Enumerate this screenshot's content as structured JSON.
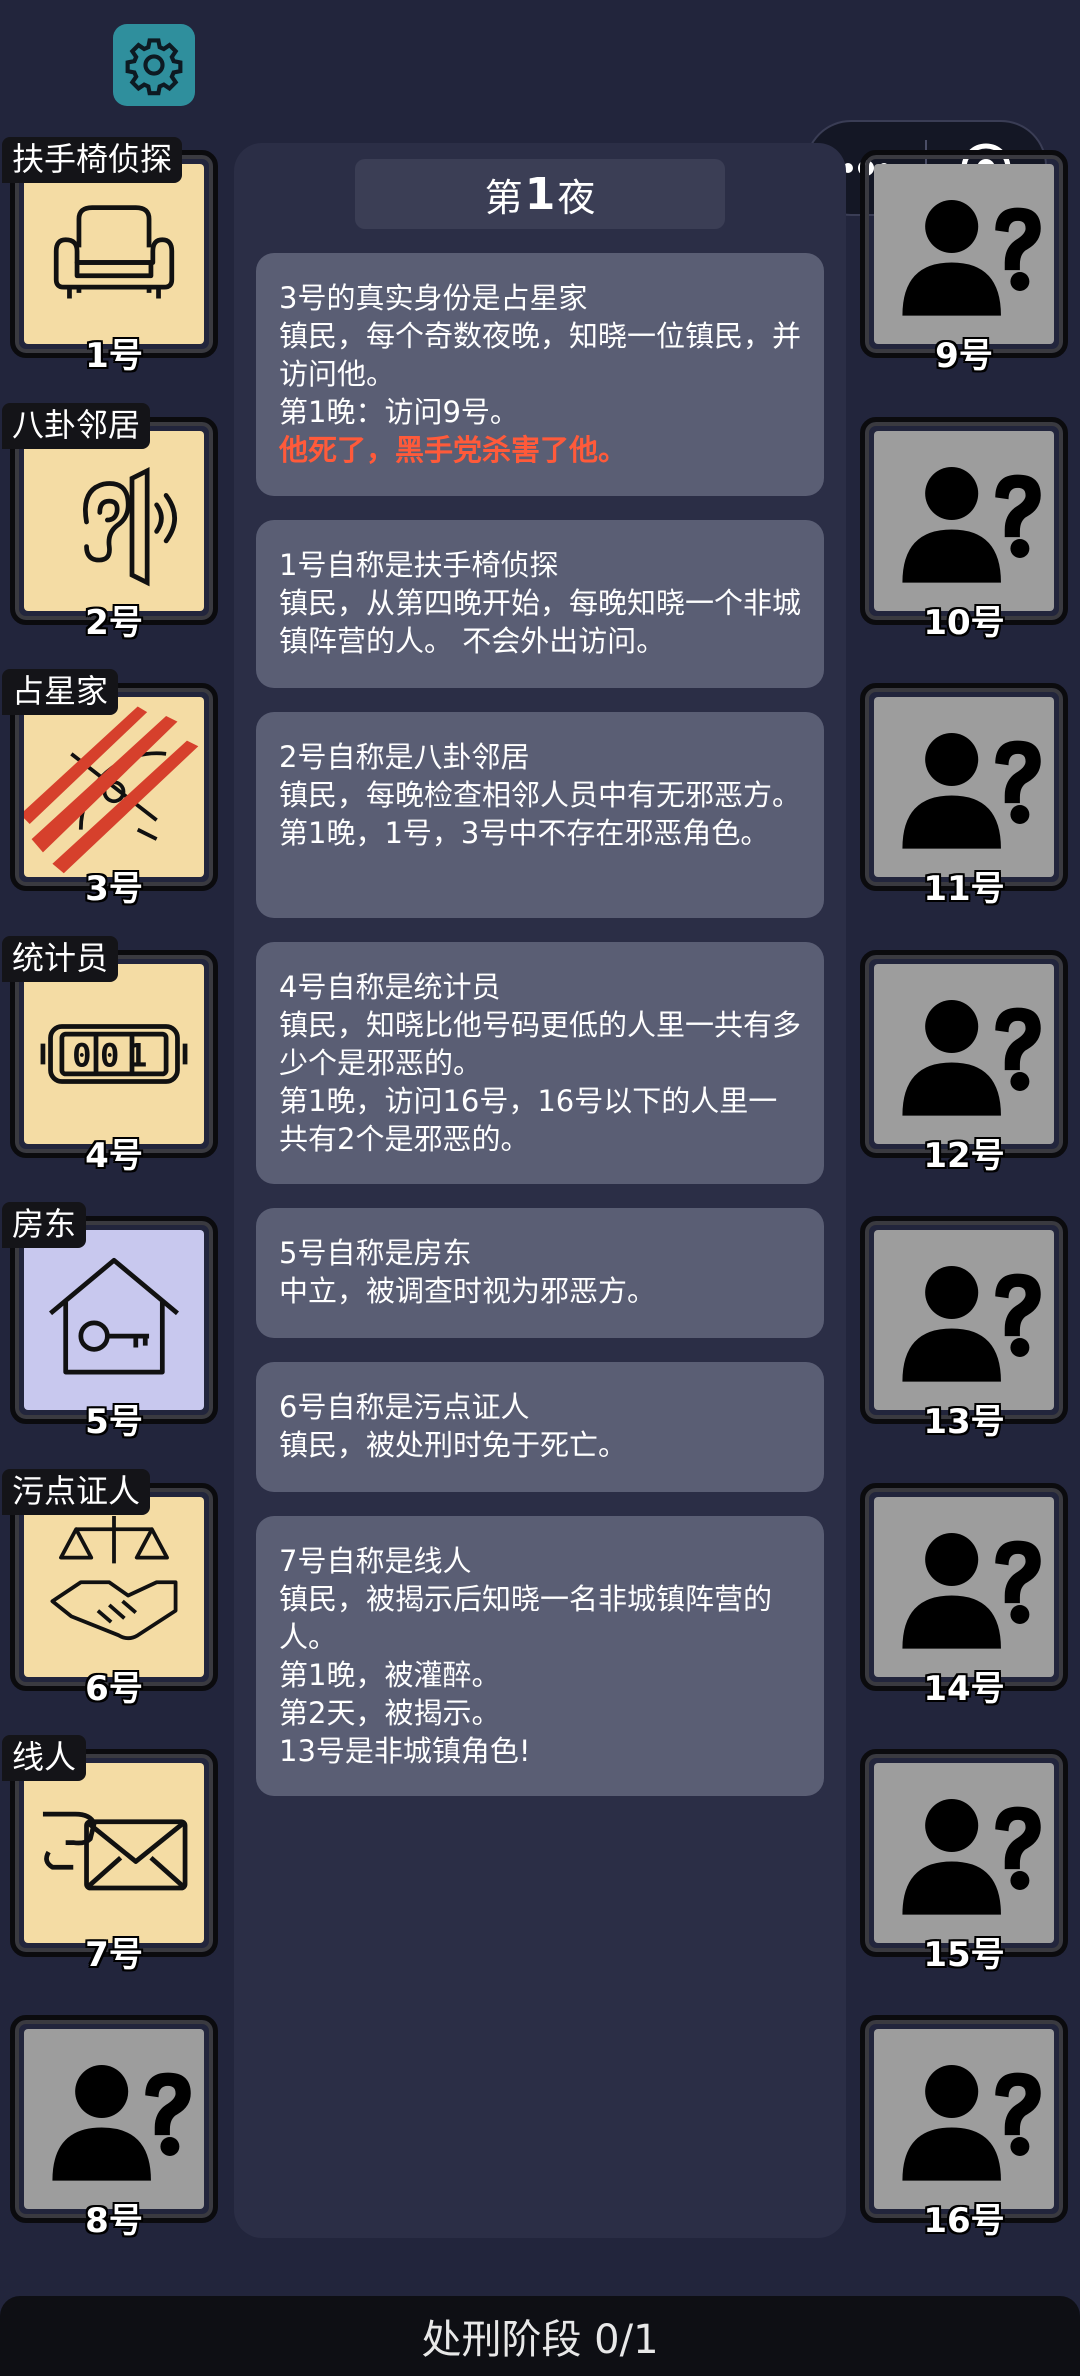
{
  "night": {
    "prefix": "第",
    "number": "1",
    "suffix": "夜"
  },
  "messages": [
    {
      "lines": [
        "3号的真实身份是占星家",
        "镇民，每个奇数夜晚，知晓一位镇民，并访问他。",
        "第1晚：访问9号。"
      ],
      "alert": "他死了，黑手党杀害了他。"
    },
    {
      "lines": [
        "1号自称是扶手椅侦探",
        "镇民，从第四晚开始，每晚知晓一个非城镇阵营的人。 不会外出访问。"
      ]
    },
    {
      "lines": [
        "2号自称是八卦邻居",
        "镇民，每晚检查相邻人员中有无邪恶方。",
        "第1晚，1号，3号中不存在邪恶角色。"
      ]
    },
    {
      "lines": [
        "4号自称是统计员",
        "镇民，知晓比他号码更低的人里一共有多少个是邪恶的。",
        "第1晚，访问16号，16号以下的人里一共有2个是邪恶的。"
      ]
    },
    {
      "lines": [
        "5号自称是房东",
        "中立，被调查时视为邪恶方。"
      ]
    },
    {
      "lines": [
        "6号自称是污点证人",
        "镇民，被处刑时免于死亡。"
      ]
    },
    {
      "lines": [
        "7号自称是线人",
        "镇民，被揭示后知晓一名非城镇阵营的人。",
        "第1晚，被灌醉。",
        "第2天，被揭示。",
        "13号是非城镇角色!"
      ]
    }
  ],
  "players_left": [
    {
      "number": "1号",
      "role": "扶手椅侦探",
      "icon": "armchair-icon",
      "bg": "yellow"
    },
    {
      "number": "2号",
      "role": "八卦邻居",
      "icon": "ear-wall-icon",
      "bg": "yellow"
    },
    {
      "number": "3号",
      "role": "占星家",
      "icon": "sextant-icon",
      "bg": "yellow",
      "dead": true
    },
    {
      "number": "4号",
      "role": "统计员",
      "icon": "counter-icon",
      "counter": "001",
      "bg": "yellow"
    },
    {
      "number": "5号",
      "role": "房东",
      "icon": "house-key-icon",
      "bg": "lilac"
    },
    {
      "number": "6号",
      "role": "污点证人",
      "icon": "scales-handshake-icon",
      "bg": "yellow"
    },
    {
      "number": "7号",
      "role": "线人",
      "icon": "envelope-hand-icon",
      "bg": "yellow"
    },
    {
      "number": "8号",
      "role": "",
      "icon": "unknown-person-icon",
      "bg": "grey"
    }
  ],
  "players_right": [
    {
      "number": "9号",
      "icon": "unknown-person-icon"
    },
    {
      "number": "10号",
      "icon": "unknown-person-icon"
    },
    {
      "number": "11号",
      "icon": "unknown-person-icon"
    },
    {
      "number": "12号",
      "icon": "unknown-person-icon"
    },
    {
      "number": "13号",
      "icon": "unknown-person-icon"
    },
    {
      "number": "14号",
      "icon": "unknown-person-icon"
    },
    {
      "number": "15号",
      "icon": "unknown-person-icon"
    },
    {
      "number": "16号",
      "icon": "unknown-person-icon"
    }
  ],
  "bottom_bar": {
    "label": "处刑阶段 0/1"
  },
  "colors": {
    "background": "#22253c",
    "panel": "#2b2e46",
    "message": "#5a5e74",
    "alert": "#ff5a3a",
    "card_yellow": "#f4dca4",
    "card_lilac": "#c8c8ee",
    "card_grey": "#9d9d9d"
  }
}
